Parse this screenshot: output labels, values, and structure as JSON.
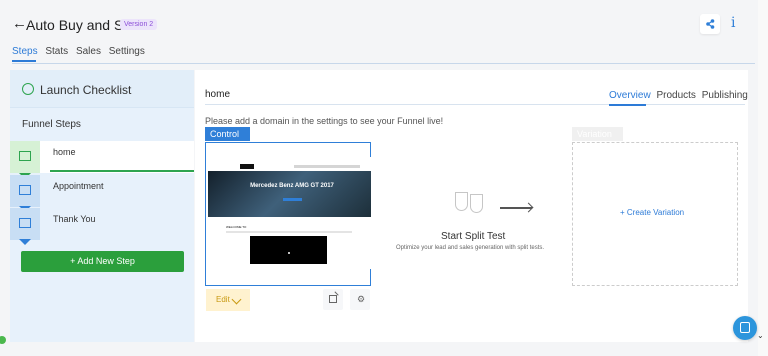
{
  "app": {
    "title": "Auto Buy and Sell",
    "version_badge": "Version 2",
    "tabs": [
      {
        "label": "Steps"
      },
      {
        "label": "Stats"
      },
      {
        "label": "Sales"
      },
      {
        "label": "Settings"
      }
    ]
  },
  "sidebar": {
    "checklist_label": "Launch Checklist",
    "section_label": "Funnel Steps",
    "steps": [
      {
        "label": "home"
      },
      {
        "label": "Appointment"
      },
      {
        "label": "Thank You"
      }
    ],
    "add_step_label": "+ Add New Step"
  },
  "main": {
    "page_name": "home",
    "domain_note": "Please add a domain in the settings to see your Funnel live!",
    "right_tabs": [
      {
        "label": "Overview"
      },
      {
        "label": "Products"
      },
      {
        "label": "Publishing"
      }
    ],
    "control": {
      "label": "Control",
      "preview_headline": "Mercedez Benz AMG GT 2017",
      "preview_welcome": "WELCOME TO"
    },
    "edit_label": "Edit",
    "split": {
      "title": "Start Split Test",
      "description": "Optimize your lead and sales generation with split tests."
    },
    "variation": {
      "label": "Variation",
      "create_label": "+ Create Variation"
    }
  },
  "icons": {
    "back": "arrow-left",
    "share": "share-icon",
    "info": "info-icon",
    "check": "check-circle-icon",
    "mail": "mail-icon",
    "external": "external-link-icon",
    "gear": "gear-icon",
    "chat": "chat-icon"
  },
  "colors": {
    "accent": "#2d7bd7",
    "success": "#2b9f3c",
    "warning": "#c99a13",
    "sidebar": "#e7f1fb"
  }
}
